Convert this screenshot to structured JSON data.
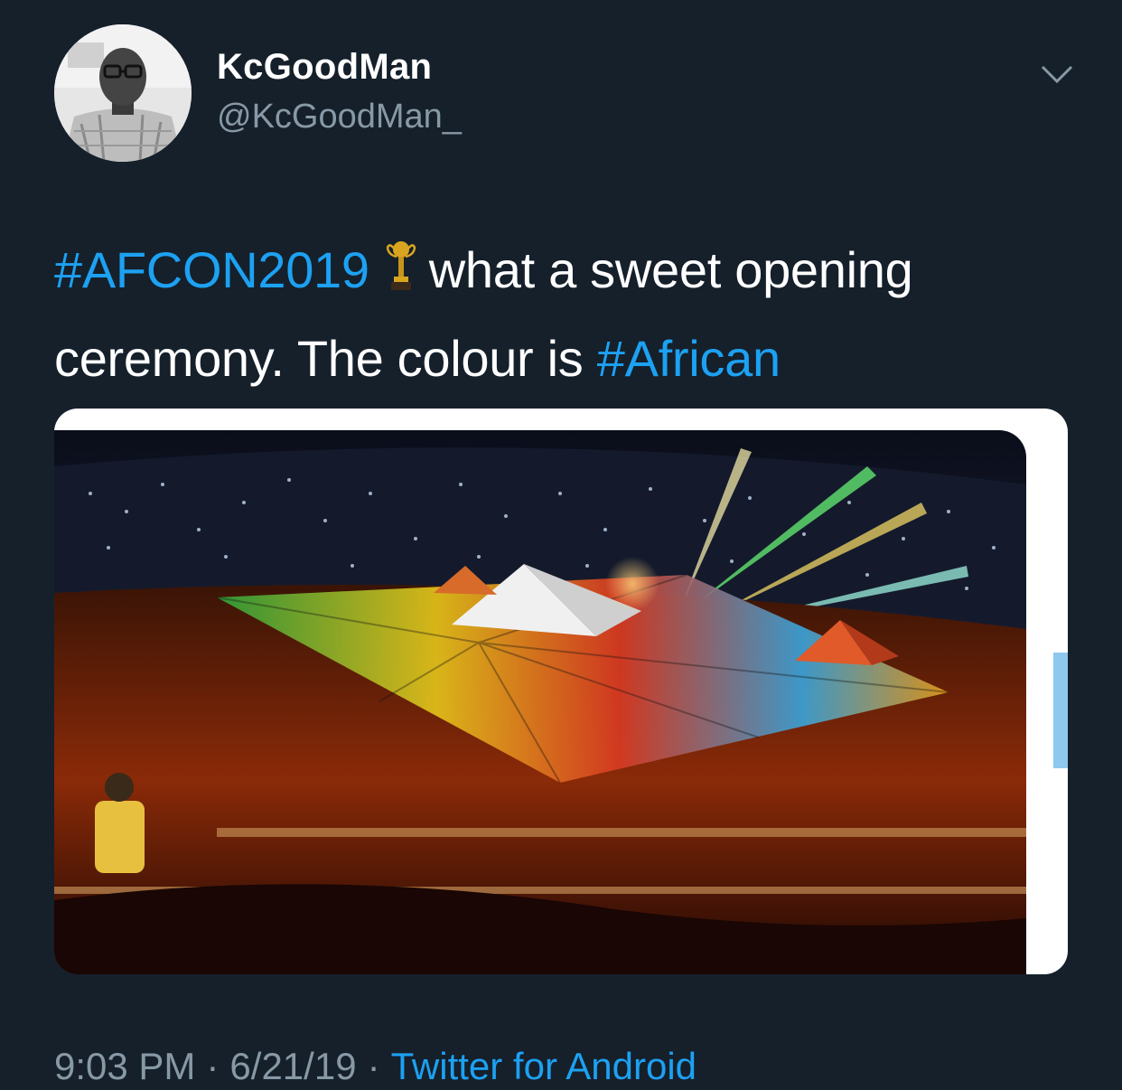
{
  "user": {
    "display_name": "KcGoodMan",
    "handle": "@KcGoodMan_"
  },
  "tweet": {
    "hashtag_1": "#AFCON2019",
    "text_1": "what a sweet opening ceremony.  The colour is ",
    "hashtag_2": "#African",
    "emoji": "trophy-icon"
  },
  "meta": {
    "time": "9:03 PM",
    "separator": "·",
    "date": "6/21/19",
    "source": "Twitter for Android"
  },
  "colors": {
    "background": "#15202b",
    "text": "#ffffff",
    "secondary_text": "#8899a6",
    "link": "#1da1f2"
  }
}
